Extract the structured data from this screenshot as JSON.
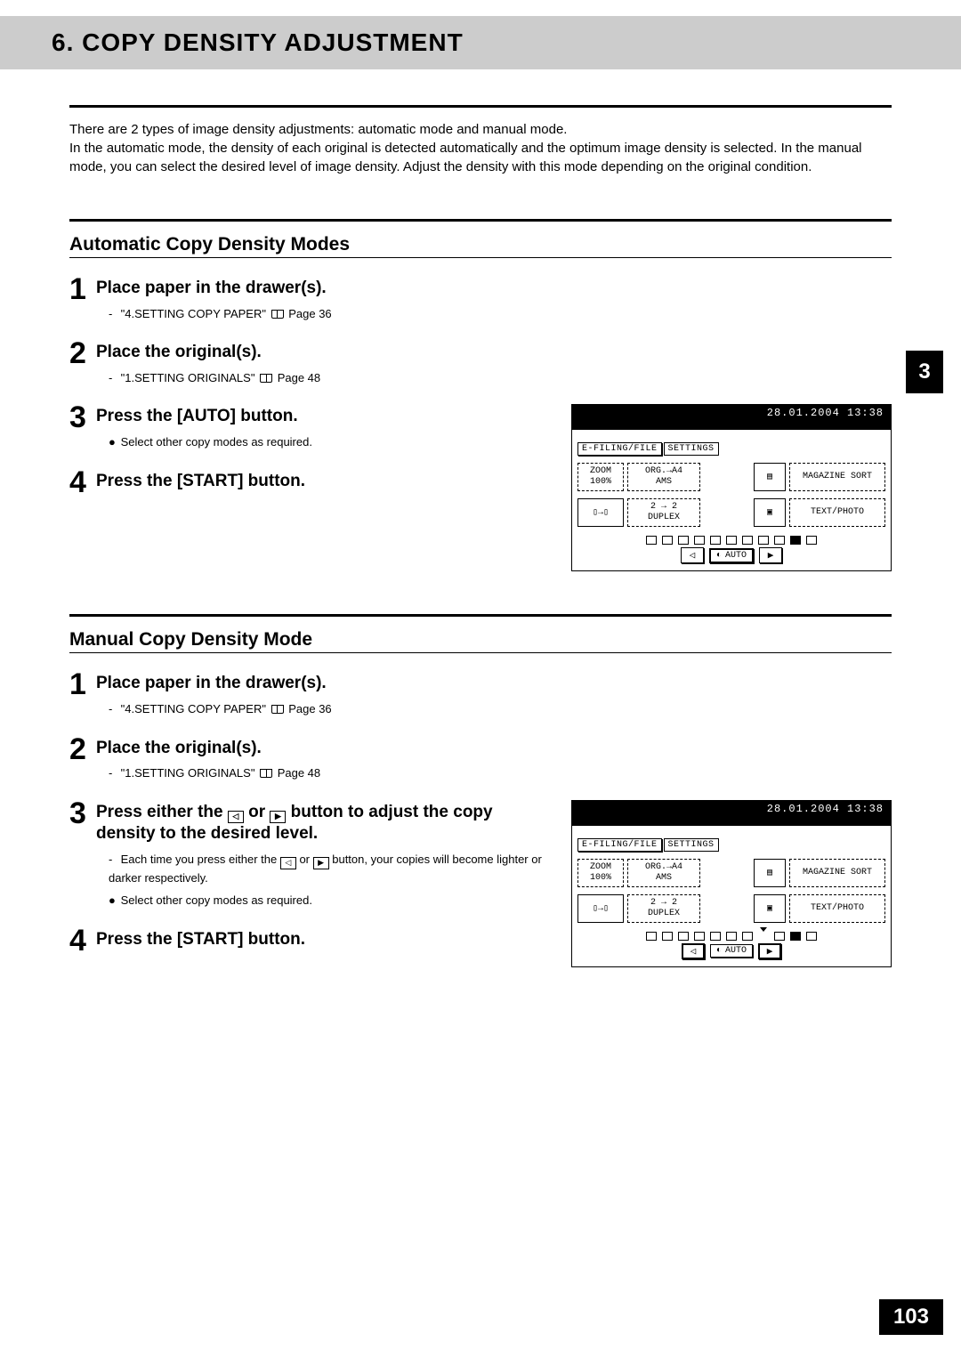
{
  "chapter_tab": "3",
  "page_number": "103",
  "title": "6. COPY DENSITY ADJUSTMENT",
  "intro": "There are 2 types of image density adjustments: automatic mode and manual mode.\nIn the automatic mode, the density of each original is detected automatically and the optimum image density is selected. In the manual mode, you can select the desired level of image density. Adjust the density with this mode depending on the original condition.",
  "section_a": {
    "title": "Automatic Copy Density Modes",
    "steps": [
      {
        "n": "1",
        "t": "Place paper in the drawer(s).",
        "ref": "\"4.SETTING COPY PAPER\"",
        "page": "Page 36"
      },
      {
        "n": "2",
        "t": "Place the original(s).",
        "ref": "\"1.SETTING ORIGINALS\"",
        "page": "Page 48"
      },
      {
        "n": "3",
        "t": "Press the [AUTO] button.",
        "note": "Select other copy modes as required."
      },
      {
        "n": "4",
        "t": "Press the [START] button."
      }
    ]
  },
  "section_b": {
    "title": "Manual Copy Density Mode",
    "steps": [
      {
        "n": "1",
        "t": "Place paper in the drawer(s).",
        "ref": "\"4.SETTING COPY PAPER\"",
        "page": "Page 36"
      },
      {
        "n": "2",
        "t": "Place the original(s).",
        "ref": "\"1.SETTING ORIGINALS\"",
        "page": "Page 48"
      },
      {
        "n": "3",
        "t_a": "Press either the ",
        "t_b": " or ",
        "t_c": " button to adjust the copy density to the desired level.",
        "sub_a": "Each time you press either the ",
        "sub_b": " or ",
        "sub_c": " button, your copies will become lighter or darker respectively.",
        "note": "Select other copy modes as required."
      },
      {
        "n": "4",
        "t": "Press the [START] button."
      }
    ]
  },
  "panel": {
    "datetime": "28.01.2004 13:38",
    "tab_efiling": "E-FILING/FILE",
    "tab_settings": "SETTINGS",
    "zoom_l1": "ZOOM",
    "zoom_l2": "100%",
    "org_l1": "ORG.→A4",
    "org_l2": "AMS",
    "mag": "MAGAZINE SORT",
    "duplex_l1": "2 → 2",
    "duplex_l2": "DUPLEX",
    "txt": "TEXT/PHOTO",
    "auto": "AUTO"
  }
}
